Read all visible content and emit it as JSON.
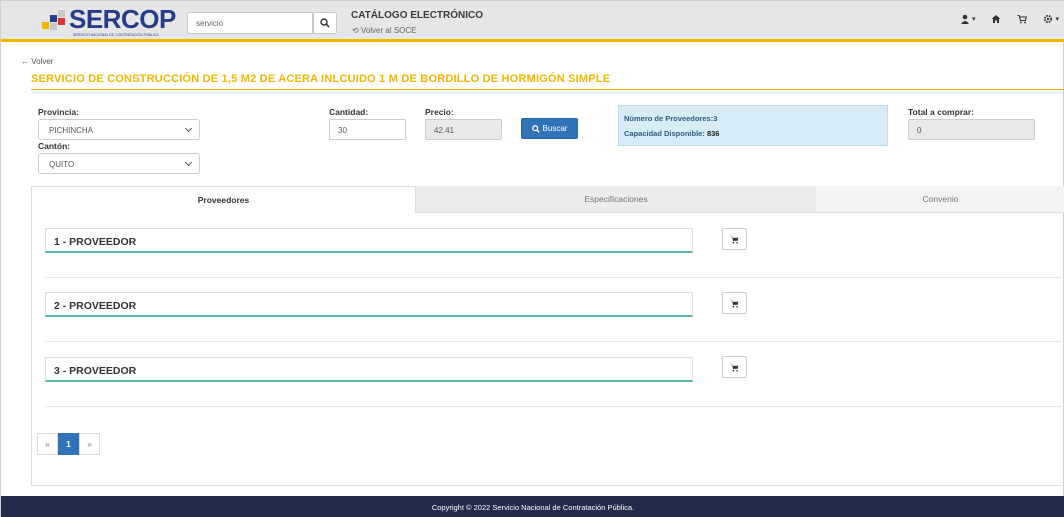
{
  "header": {
    "logo_text": "SERCOP",
    "logo_subtitle": "SERVICIO NACIONAL DE CONTRATACIÓN PÚBLICA",
    "search_value": "servicio",
    "catalog_title": "CATÁLOGO ELECTRÓNICO",
    "back_to_soce": "Volver al SOCE",
    "accent_color": "#f2b600",
    "brand_color": "#243c8a",
    "icons": [
      "user-icon",
      "home-icon",
      "cart-icon",
      "settings-icon"
    ]
  },
  "page": {
    "back_label": "Volver",
    "title": "SERVICIO DE CONSTRUCCIÓN DE 1,5 M2 DE ACERA INLCUIDO 1 M DE BORDILLO DE HORMIGÓN SIMPLE"
  },
  "form": {
    "provincia_label": "Provincia:",
    "provincia_value": "PICHINCHA",
    "canton_label": "Cantón:",
    "canton_value": "QUITO",
    "cantidad_label": "Cantidad:",
    "cantidad_value": "30",
    "precio_label": "Precio:",
    "precio_value": "42.41",
    "buscar_label": "Buscar",
    "total_label": "Total a comprar:",
    "total_value": "0"
  },
  "info": {
    "proveedores": "Número de Proveedores:3",
    "capacidad_label": "Capacidad Disponible: ",
    "capacidad_value": "836"
  },
  "tabs": [
    {
      "label": "Proveedores"
    },
    {
      "label": "Especificaciones"
    },
    {
      "label": "Convenio"
    }
  ],
  "providers": [
    {
      "label": "1 - PROVEEDOR"
    },
    {
      "label": "2 - PROVEEDOR"
    },
    {
      "label": "3 - PROVEEDOR"
    }
  ],
  "pagination": {
    "prev": "«",
    "current": "1",
    "next": "»"
  },
  "footer": {
    "copyright": "Copyright © 2022 Servicio Nacional de Contratación Pública."
  }
}
